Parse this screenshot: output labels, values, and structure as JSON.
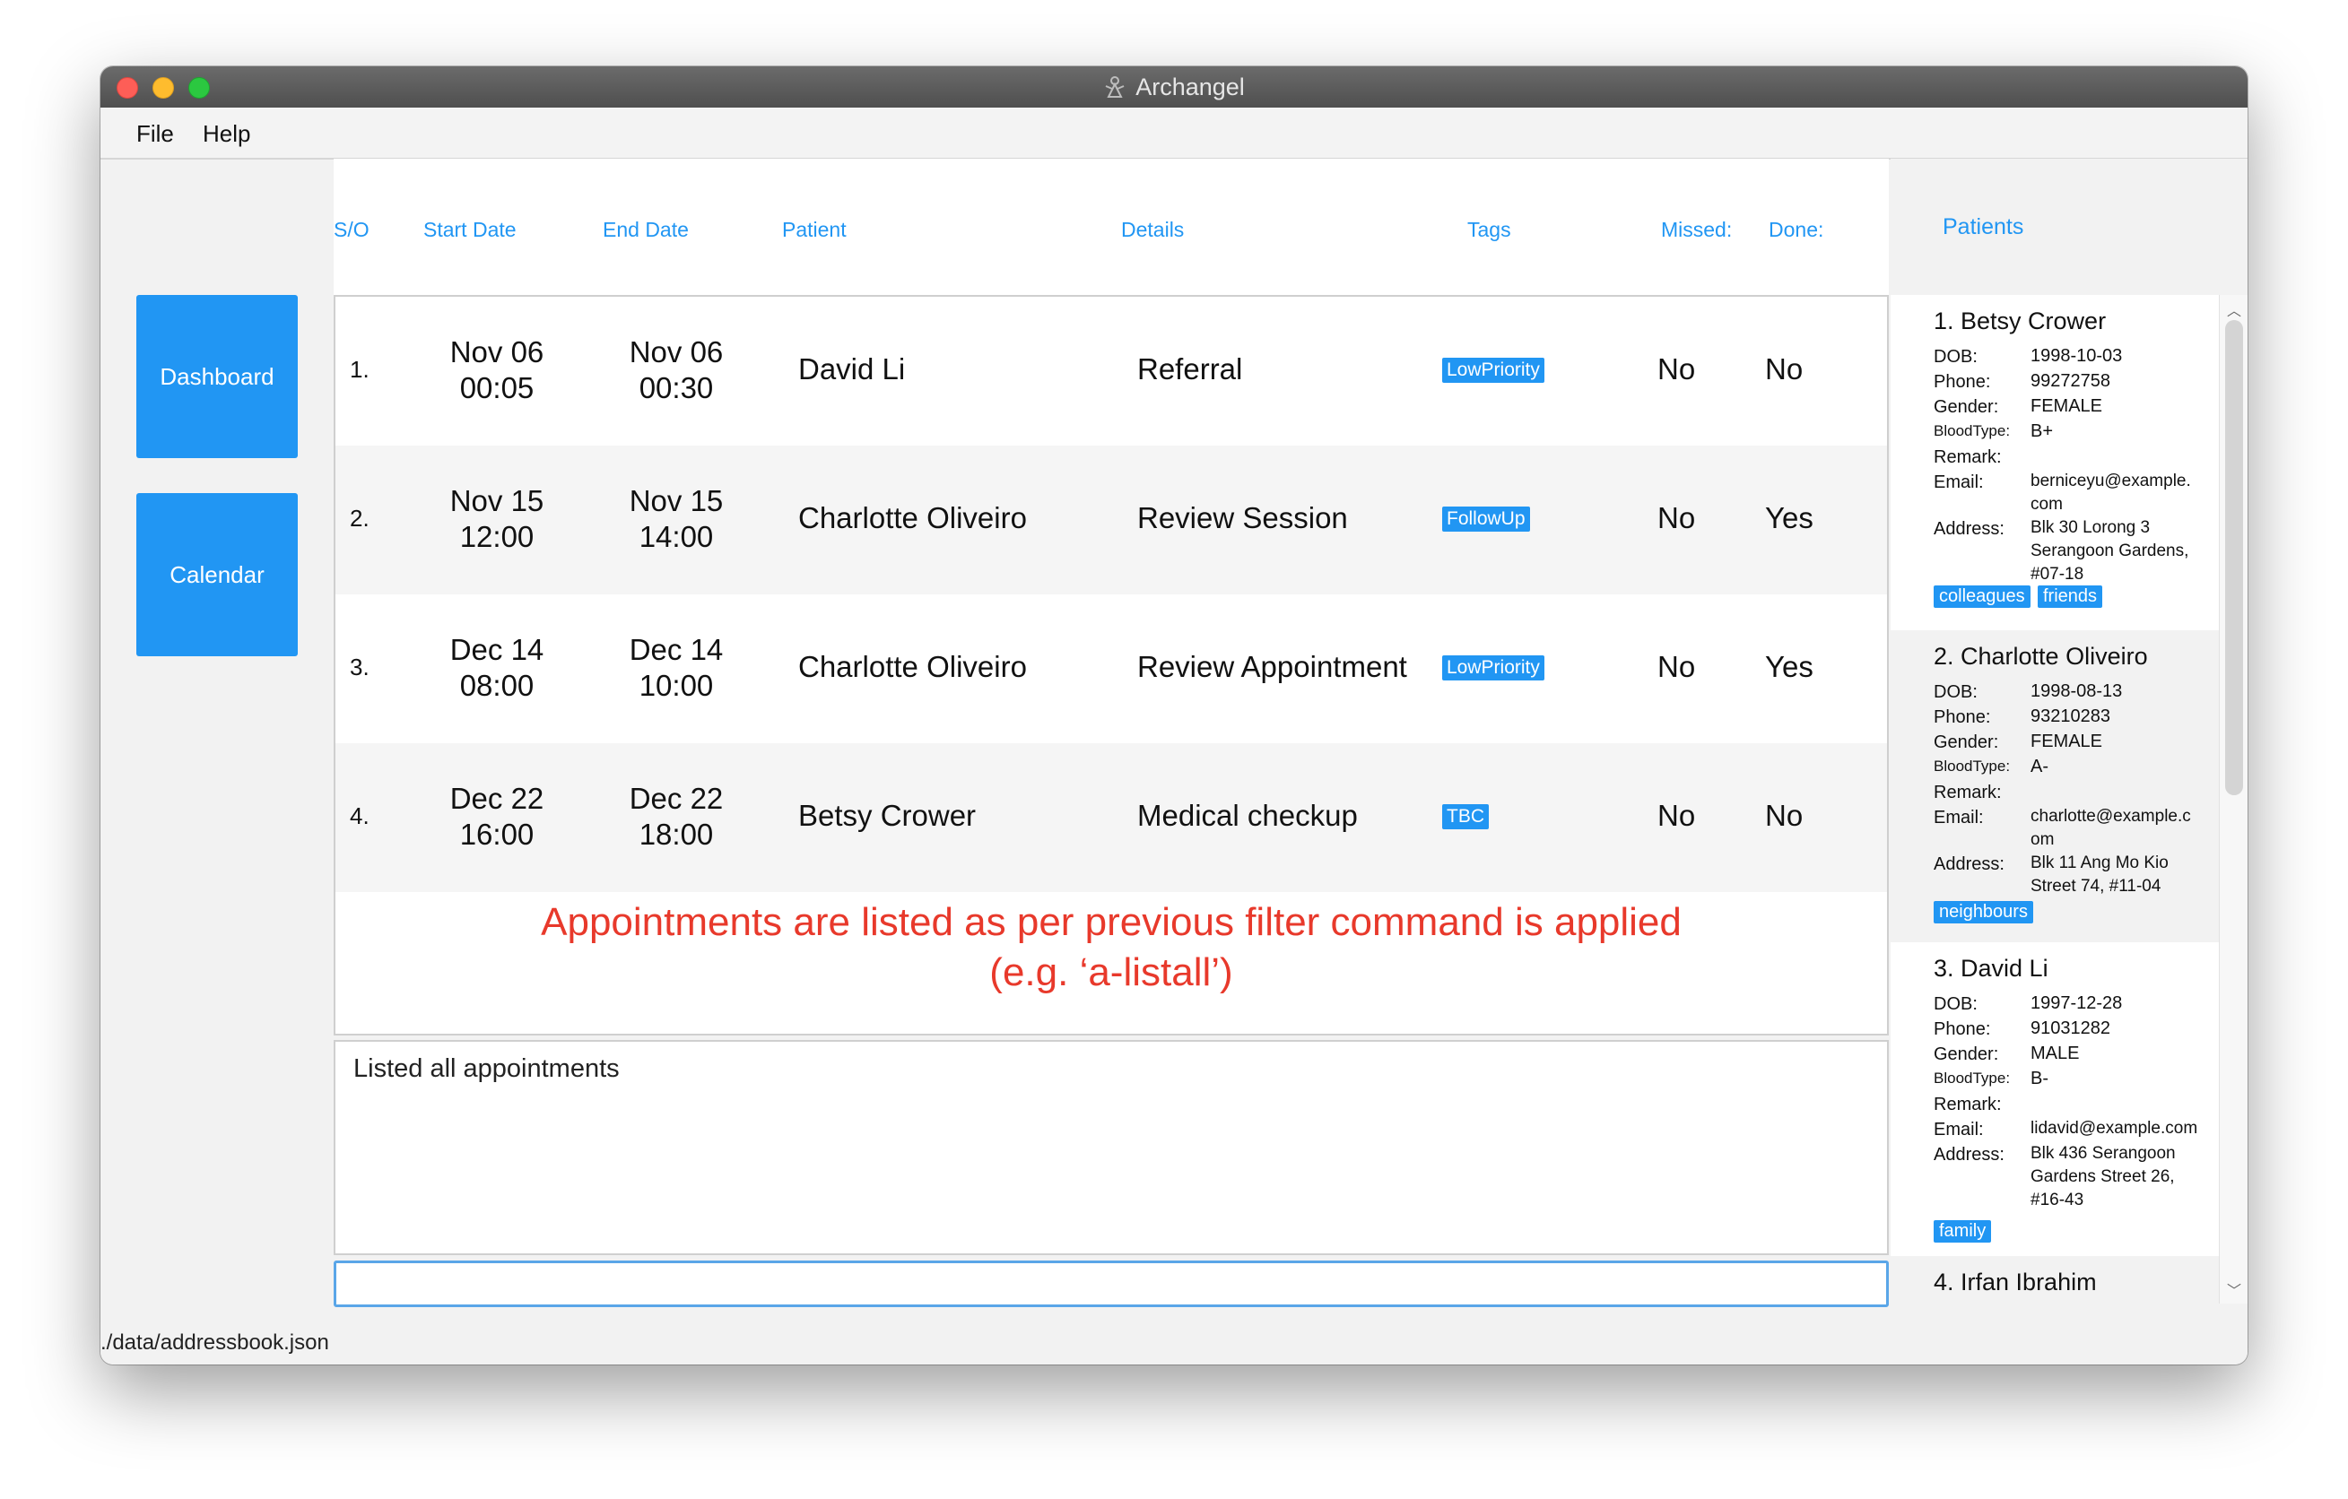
{
  "window": {
    "title": "Archangel"
  },
  "menu": {
    "file": "File",
    "help": "Help"
  },
  "nav": {
    "dashboard": "Dashboard",
    "calendar": "Calendar"
  },
  "columns": {
    "so": "S/O",
    "start": "Start Date",
    "end": "End Date",
    "patient": "Patient",
    "details": "Details",
    "tags": "Tags",
    "missed": "Missed:",
    "done": "Done:"
  },
  "appointments": [
    {
      "so": "1.",
      "start_date": "Nov 06",
      "start_time": "00:05",
      "end_date": "Nov 06",
      "end_time": "00:30",
      "patient": "David Li",
      "details": "Referral",
      "tag": "LowPriority",
      "missed": "No",
      "done": "No"
    },
    {
      "so": "2.",
      "start_date": "Nov 15",
      "start_time": "12:00",
      "end_date": "Nov 15",
      "end_time": "14:00",
      "patient": "Charlotte Oliveiro",
      "details": "Review Session",
      "tag": "FollowUp",
      "missed": "No",
      "done": "Yes"
    },
    {
      "so": "3.",
      "start_date": "Dec 14",
      "start_time": "08:00",
      "end_date": "Dec 14",
      "end_time": "10:00",
      "patient": "Charlotte Oliveiro",
      "details": "Review Appointment",
      "tag": "LowPriority",
      "missed": "No",
      "done": "Yes"
    },
    {
      "so": "4.",
      "start_date": "Dec 22",
      "start_time": "16:00",
      "end_date": "Dec 22",
      "end_time": "18:00",
      "patient": "Betsy Crower",
      "details": "Medical checkup",
      "tag": "TBC",
      "missed": "No",
      "done": "No"
    }
  ],
  "annotation": {
    "line1": "Appointments are listed as per previous filter command is applied",
    "line2": "(e.g. ‘a-listall’)"
  },
  "result_text": "Listed all appointments",
  "command": {
    "value": ""
  },
  "status": "./data/addressbook.json",
  "patients_panel": {
    "title": "Patients",
    "labels": {
      "dob": "DOB:",
      "phone": "Phone:",
      "gender": "Gender:",
      "blood": "BloodType:",
      "remark": "Remark:",
      "email": "Email:",
      "address": "Address:"
    },
    "patients": [
      {
        "name": "1. Betsy Crower",
        "dob": "1998-10-03",
        "phone": "99272758",
        "gender": "FEMALE",
        "blood": "B+",
        "remark": "",
        "email1": "berniceyu@example.",
        "email2": "com",
        "addr1": "Blk 30 Lorong 3",
        "addr2": "Serangoon Gardens,",
        "addr3": "#07-18",
        "tags": [
          "colleagues",
          "friends"
        ]
      },
      {
        "name": "2. Charlotte Oliveiro",
        "dob": "1998-08-13",
        "phone": "93210283",
        "gender": "FEMALE",
        "blood": "A-",
        "remark": "",
        "email1": "charlotte@example.c",
        "email2": "om",
        "addr1": "Blk 11 Ang Mo Kio",
        "addr2": "Street 74, #11-04",
        "tags": [
          "neighbours"
        ]
      },
      {
        "name": "3. David Li",
        "dob": "1997-12-28",
        "phone": "91031282",
        "gender": "MALE",
        "blood": "B-",
        "remark": "",
        "email1": "lidavid@example.com",
        "addr1": "Blk 436 Serangoon",
        "addr2": "Gardens Street 26,",
        "addr3": "#16-43",
        "tags": [
          "family"
        ]
      },
      {
        "name": "4. Irfan Ibrahim"
      }
    ]
  }
}
